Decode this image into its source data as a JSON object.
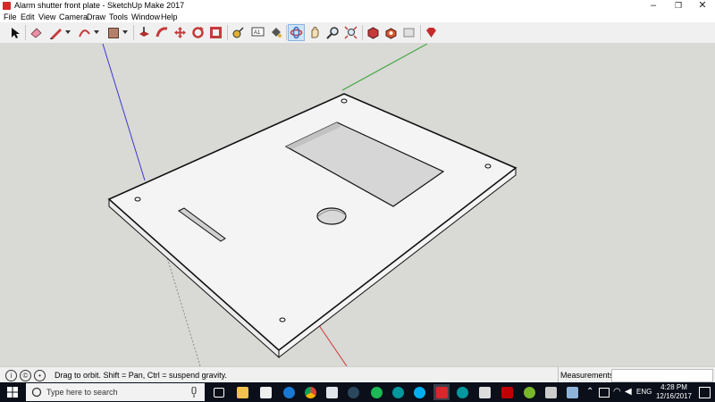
{
  "window": {
    "title": "Alarm shutter front plate - SketchUp Make 2017",
    "minimize": "–",
    "maximize": "❐",
    "close": "✕"
  },
  "menu": [
    "File",
    "Edit",
    "View",
    "Camera",
    "Draw",
    "Tools",
    "Window",
    "Help"
  ],
  "toolbar": {
    "tools": [
      "select-icon",
      "eraser-icon",
      "pencil-line-icon",
      "arc-icon",
      "rectangle-icon",
      "push-pull-icon",
      "follow-me-icon",
      "move-icon",
      "rotate-icon",
      "offset-icon",
      "tape-measure-icon",
      "text-icon",
      "paint-bucket-icon",
      "orbit-icon",
      "pan-icon",
      "zoom-icon",
      "zoom-extents-icon",
      "warehouse-icon",
      "extension-warehouse-icon",
      "layout-icon",
      "ruby-icon"
    ]
  },
  "status": {
    "message": "Drag to orbit. Shift = Pan, Ctrl = suspend gravity.",
    "measurements_label": "Measurements",
    "measurements_value": ""
  },
  "taskbar": {
    "search_placeholder": "Type here to search",
    "language": "ENG",
    "time": "4:28 PM",
    "date": "12/16/2017",
    "apps": [
      "task-view-icon",
      "file-explorer-icon",
      "store-icon",
      "edge-icon",
      "chrome-icon",
      "mail-icon",
      "steam-icon",
      "spotify-icon",
      "arduino-icon",
      "skype-icon",
      "arduino-icon",
      "sketchup-icon",
      "picture-icon",
      "filezilla-icon",
      "utorrent-icon",
      "media-icon",
      "arduino-icon",
      "paint-icon"
    ]
  },
  "colors": {
    "accent_active": "#cde3f7",
    "sketchup_red": "#d9262a",
    "taskbar_bg": "#0a0f1a",
    "viewport_bg": "#d9d9d5",
    "axis_blue": "#3a3ad0",
    "axis_green": "#3aa33a",
    "axis_red": "#cc3a3a"
  }
}
